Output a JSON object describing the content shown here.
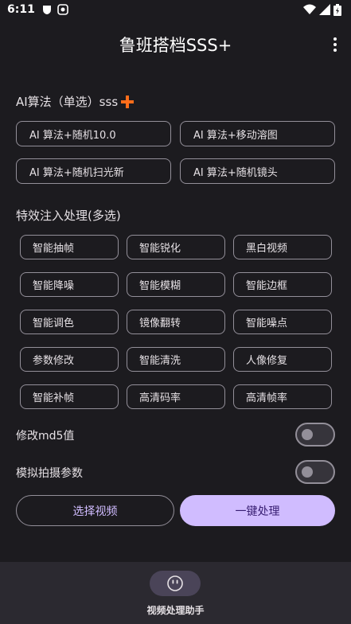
{
  "status_bar": {
    "time": "6:11"
  },
  "app": {
    "title": "鲁班搭档SSS+"
  },
  "ai_section": {
    "title": "AI算法（单选）sss",
    "buttons": [
      "AI 算法+随机10.0",
      "AI 算法+移动溶图",
      "AI 算法+随机扫光新",
      "AI 算法+随机镜头"
    ]
  },
  "effects_section": {
    "title": "特效注入处理(多选)",
    "chips": [
      "智能抽帧",
      "智能锐化",
      "黑白视频",
      "智能降噪",
      "智能模糊",
      "智能边框",
      "智能调色",
      "镜像翻转",
      "智能噪点",
      "参数修改",
      "智能清洗",
      "人像修复",
      "智能补帧",
      "高清码率",
      "高清帧率"
    ]
  },
  "toggles": {
    "md5_label": "修改md5值",
    "shoot_label": "模拟拍摄参数"
  },
  "actions": {
    "select_video": "选择视频",
    "one_click": "一键处理"
  },
  "bottom_nav": {
    "label": "视频处理助手"
  },
  "colors": {
    "accent": "#d0bcff",
    "plus": "#ff6d1a",
    "background": "#1c1b1f"
  }
}
